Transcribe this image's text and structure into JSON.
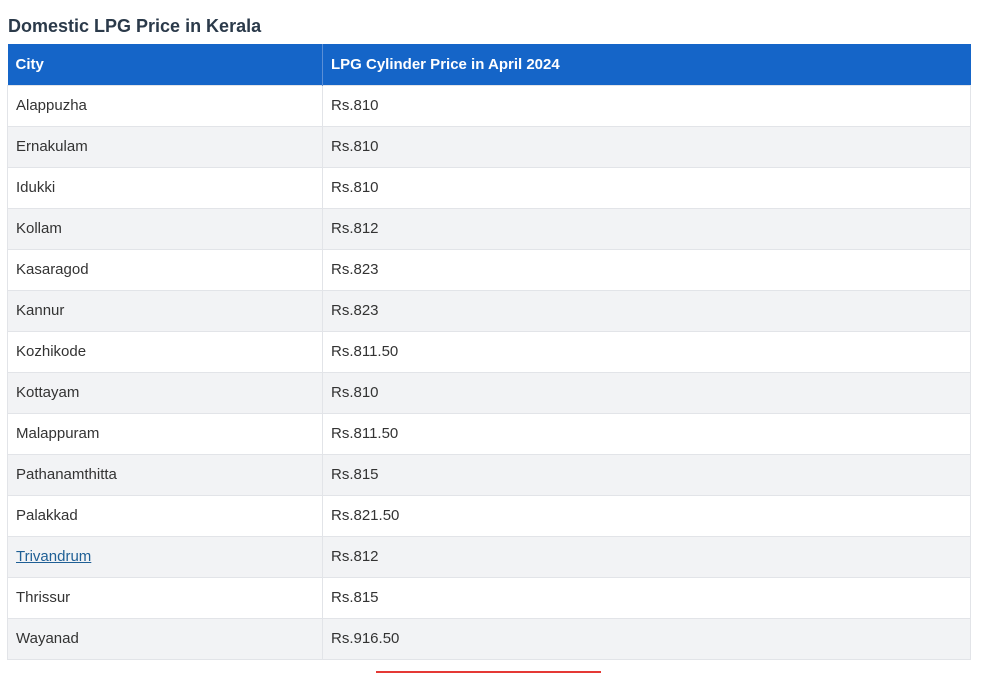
{
  "page": {
    "title": "Domestic LPG Price in Kerala"
  },
  "table": {
    "headers": [
      "City",
      "LPG Cylinder Price in April 2024"
    ],
    "rows": [
      {
        "city": "Alappuzha",
        "price": "Rs.810",
        "link": false
      },
      {
        "city": "Ernakulam",
        "price": "Rs.810",
        "link": false
      },
      {
        "city": "Idukki",
        "price": "Rs.810",
        "link": false
      },
      {
        "city": "Kollam",
        "price": "Rs.812",
        "link": false
      },
      {
        "city": "Kasaragod",
        "price": "Rs.823",
        "link": false
      },
      {
        "city": "Kannur",
        "price": "Rs.823",
        "link": false
      },
      {
        "city": "Kozhikode",
        "price": "Rs.811.50",
        "link": false
      },
      {
        "city": "Kottayam",
        "price": "Rs.810",
        "link": false
      },
      {
        "city": "Malappuram",
        "price": "Rs.811.50",
        "link": false
      },
      {
        "city": "Pathanamthitta",
        "price": "Rs.815",
        "link": false
      },
      {
        "city": "Palakkad",
        "price": "Rs.821.50",
        "link": false
      },
      {
        "city": "Trivandrum",
        "price": "Rs.812",
        "link": true
      },
      {
        "city": "Thrissur",
        "price": "Rs.815",
        "link": false
      },
      {
        "city": "Wayanad",
        "price": "Rs.916.50",
        "link": false
      }
    ]
  },
  "colors": {
    "header_bg": "#1565c8",
    "link": "#1f5f95",
    "accent": "#e53935"
  }
}
